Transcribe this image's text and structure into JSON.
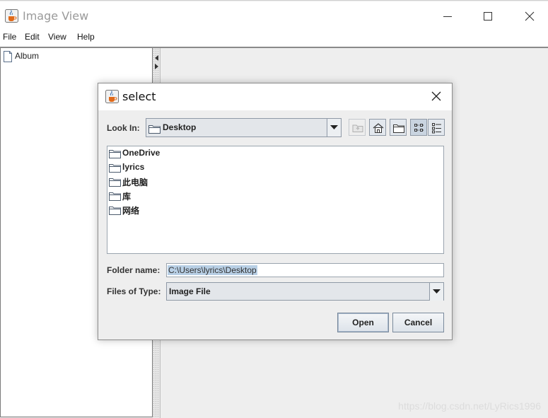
{
  "window": {
    "title": "Image View",
    "icon": "java-cup-icon",
    "controls": [
      "minimize-icon",
      "maximize-icon",
      "close-icon"
    ]
  },
  "menu": {
    "items": [
      "File",
      "Edit",
      "View",
      "Help"
    ]
  },
  "tree": {
    "root_label": "Album",
    "root_icon": "document-icon"
  },
  "dialog": {
    "title": "select",
    "icon": "java-cup-icon",
    "look_in_label": "Look In:",
    "look_in_value": "Desktop",
    "toolbar_icons": [
      "up-one-level-icon",
      "home-icon",
      "new-folder-icon",
      "list-view-icon",
      "details-view-icon"
    ],
    "files": [
      {
        "name": "OneDrive",
        "icon": "folder-icon"
      },
      {
        "name": "lyrics",
        "icon": "folder-icon"
      },
      {
        "name": "此电脑",
        "icon": "folder-icon"
      },
      {
        "name": "库",
        "icon": "folder-icon"
      },
      {
        "name": "网络",
        "icon": "folder-icon"
      }
    ],
    "folder_name_label": "Folder name:",
    "folder_name_value": "C:\\Users\\lyrics\\Desktop",
    "file_type_label": "Files of Type:",
    "file_type_value": "Image File",
    "open_label": "Open",
    "cancel_label": "Cancel"
  },
  "watermark": "https://blog.csdn.net/LyRics1996",
  "colors": {
    "selection": "#b8cfe5",
    "button_border": "#7a8a9c",
    "control_border": "#8f99a6"
  }
}
